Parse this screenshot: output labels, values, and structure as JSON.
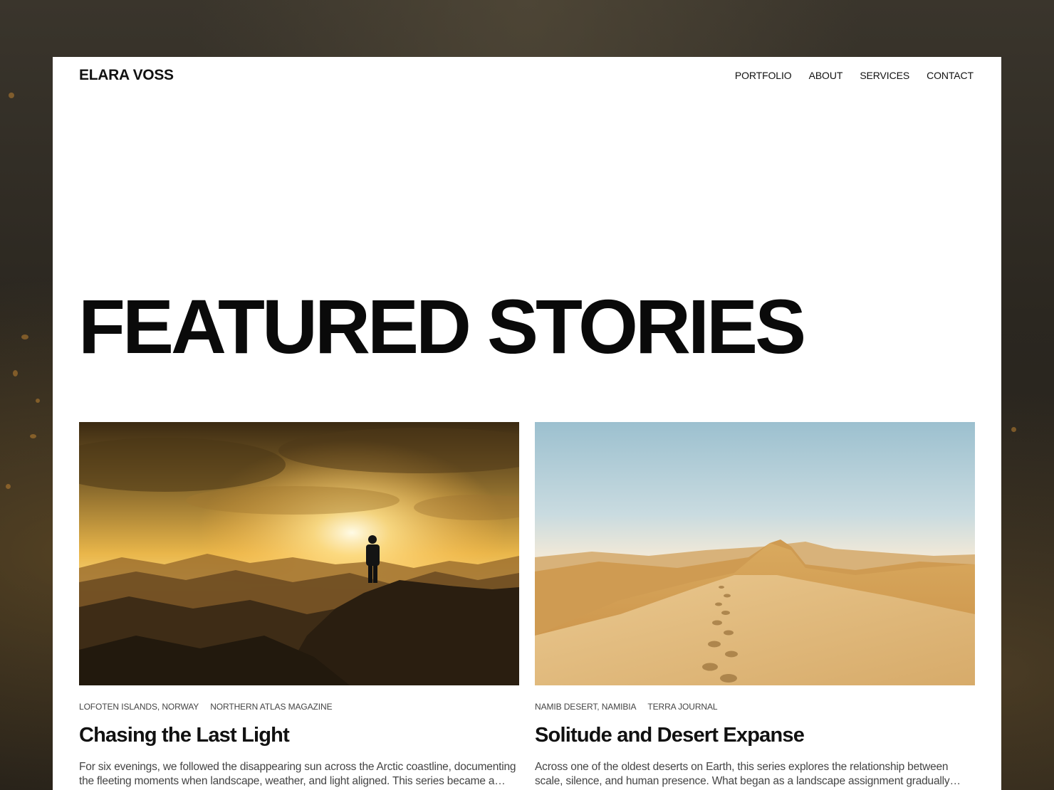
{
  "brand": "ELARA VOSS",
  "nav": {
    "items": [
      "PORTFOLIO",
      "ABOUT",
      "SERVICES",
      "CONTACT"
    ]
  },
  "hero": {
    "title": "FEATURED STORIES"
  },
  "stories": [
    {
      "location": "LOFOTEN ISLANDS, NORWAY",
      "publication": "NORTHERN ATLAS MAGAZINE",
      "title": "Chasing the Last Light",
      "excerpt": "For six evenings, we followed the disappearing sun across the Arctic coastline, documenting the fleeting moments when landscape, weather, and light aligned. This series became a study of patience and timing.",
      "image": "sunset-mountain-hiker-photo"
    },
    {
      "location": "NAMIB DESERT, NAMIBIA",
      "publication": "TERRA JOURNAL",
      "title": "Solitude and Desert Expanse",
      "excerpt": "Across one of the oldest deserts on Earth, this series explores the relationship between scale, silence, and human presence. What began as a landscape assignment gradually became something more personal.",
      "image": "desert-dune-footprints-photo"
    }
  ]
}
